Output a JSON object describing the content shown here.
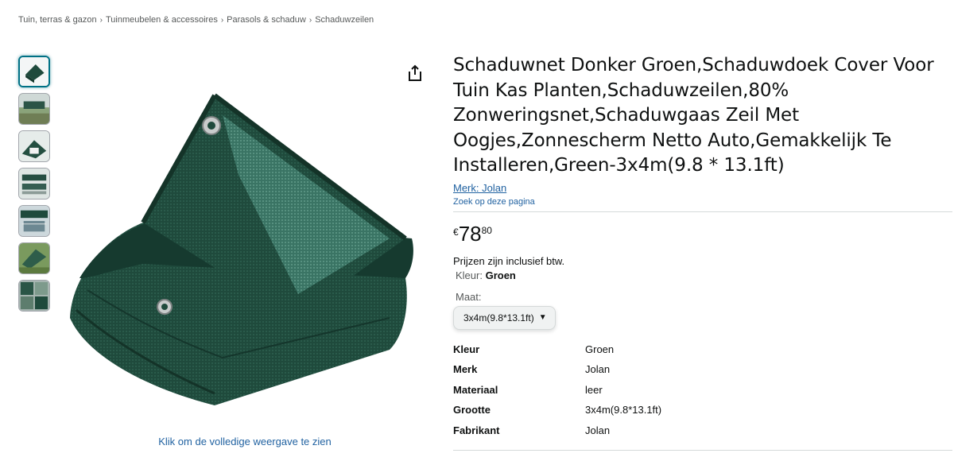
{
  "breadcrumb": [
    {
      "label": "Tuin, terras & gazon"
    },
    {
      "label": "Tuinmeubelen & accessoires"
    },
    {
      "label": "Parasols & schaduw"
    },
    {
      "label": "Schaduwzeilen"
    }
  ],
  "breadcrumb_separator": "›",
  "thumbnail_count": 7,
  "product": {
    "title": "Schaduwnet Donker Groen,Schaduwdoek Cover Voor Tuin Kas Planten,Schaduwzeilen,80% Zonweringsnet,Schaduwgaas Zeil Met Oogjes,Zonnescherm Netto Auto,Gemakkelijk Te Installeren,Green-3x4m(9.8 * 13.1ft)",
    "brand_link": "Merk: Jolan",
    "search_page": "Zoek op deze pagina",
    "price": {
      "symbol": "€",
      "whole": "78",
      "fraction": "80"
    },
    "vat_note": "Prijzen zijn inclusief btw.",
    "color_label": "Kleur:",
    "color_value": "Groen",
    "size_label": "Maat:",
    "size_selected": "3x4m(9.8*13.1ft)",
    "specs": [
      {
        "key": "Kleur",
        "value": "Groen"
      },
      {
        "key": "Merk",
        "value": "Jolan"
      },
      {
        "key": "Materiaal",
        "value": "leer"
      },
      {
        "key": "Grootte",
        "value": "3x4m(9.8*13.1ft)"
      },
      {
        "key": "Fabrikant",
        "value": "Jolan"
      }
    ]
  },
  "image": {
    "full_view_link": "Klik om de volledige weergave te zien"
  },
  "icons": {
    "share": "share-icon",
    "dropdown": "chevron-down-icon"
  },
  "colors": {
    "link": "#2162a1",
    "text": "#0f1111",
    "muted": "#565959",
    "net": "#1f4a3c",
    "thumb_active": "#007185"
  }
}
